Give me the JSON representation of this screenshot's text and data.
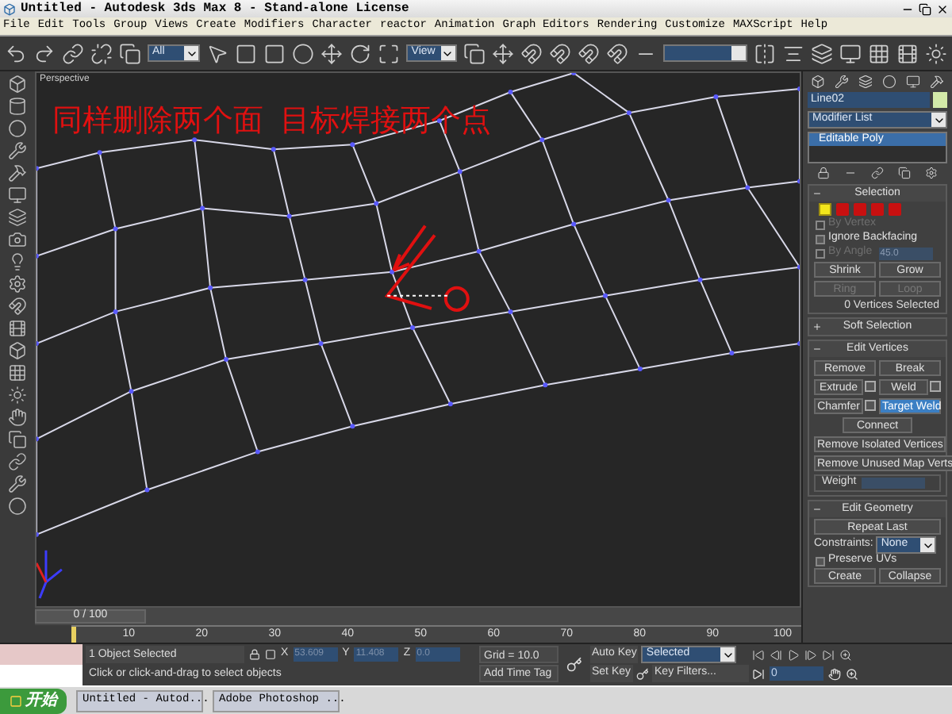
{
  "window": {
    "title": "Untitled - Autodesk 3ds Max 8  - Stand-alone License"
  },
  "menu": [
    "File",
    "Edit",
    "Tools",
    "Group",
    "Views",
    "Create",
    "Modifiers",
    "Character",
    "reactor",
    "Animation",
    "Graph Editors",
    "Rendering",
    "Customize",
    "MAXScript",
    "Help"
  ],
  "toolbar": {
    "selection_filter": "All",
    "reference_coord": "View"
  },
  "viewport": {
    "label": "Perspective",
    "annotation": "同样删除两个面  目标焊接两个点"
  },
  "command_panel": {
    "object_name": "Line02",
    "modifier_list": "Modifier List",
    "stack": [
      {
        "label": "Editable Poly",
        "selected": true
      }
    ],
    "selection": {
      "title": "Selection",
      "expanded": true,
      "subobjects": [
        {
          "selected": true
        },
        {
          "selected": false
        },
        {
          "selected": false
        },
        {
          "selected": false
        },
        {
          "selected": false
        }
      ],
      "checks": [
        {
          "label": "By Vertex",
          "checked": false,
          "disabled": true
        },
        {
          "label": "Ignore Backfacing",
          "checked": false,
          "disabled": false
        }
      ],
      "by_angle": {
        "label": "By Angle",
        "checked": false,
        "disabled": true,
        "value": "45.0"
      },
      "buttons": [
        {
          "label": "Shrink",
          "disabled": false
        },
        {
          "label": "Grow",
          "disabled": false
        },
        {
          "label": "Ring",
          "disabled": true
        },
        {
          "label": "Loop",
          "disabled": true
        }
      ],
      "status": "0 Vertices Selected"
    },
    "soft_selection": {
      "title": "Soft Selection",
      "expanded": false
    },
    "edit_vertices": {
      "title": "Edit Vertices",
      "expanded": true,
      "buttons": [
        {
          "label": "Remove",
          "kind": "half",
          "selected": false
        },
        {
          "label": "Break",
          "kind": "half",
          "selected": false
        },
        {
          "label": "Extrude",
          "kind": "half_settings",
          "selected": false
        },
        {
          "label": "Weld",
          "kind": "half_settings",
          "selected": false
        },
        {
          "label": "Chamfer",
          "kind": "half_settings",
          "selected": false
        },
        {
          "label": "Target Weld",
          "kind": "half",
          "selected": true
        },
        {
          "label": "Connect",
          "kind": "center",
          "selected": false
        },
        {
          "label": "Remove Isolated Vertices",
          "kind": "full",
          "selected": false
        },
        {
          "label": "Remove Unused Map Verts",
          "kind": "full",
          "selected": false
        }
      ],
      "weight_label": "Weight"
    },
    "edit_geometry": {
      "title": "Edit Geometry",
      "expanded": true,
      "repeat": "Repeat Last",
      "constraints_label": "Constraints:",
      "constraints_value": "None",
      "preserve_uvs": {
        "label": "Preserve UVs",
        "checked": false,
        "disabled": false
      },
      "buttons": [
        "Create",
        "Collapse"
      ]
    }
  },
  "timeline": {
    "position": "0 / 100",
    "level": 0,
    "ticks": [
      "10",
      "20",
      "30",
      "40",
      "50",
      "60",
      "70",
      "80",
      "90",
      "100"
    ]
  },
  "status": {
    "selection": "1 Object Selected",
    "prompt": "Click or click-and-drag to select objects",
    "x_label": "X",
    "x_value": "53.609",
    "y_label": "Y",
    "y_value": "11.408",
    "z_label": "Z",
    "z_value": "0.0",
    "grid": "Grid = 10.0",
    "add_time_tag": "Add Time Tag",
    "auto_key": "Auto Key",
    "key_mode": "Selected",
    "set_key": "Set Key",
    "key_filters": "Key Filters...",
    "frame": "0"
  },
  "taskbar": {
    "start": "开始",
    "tasks": [
      "Untitled - Autod...",
      "Adobe Photoshop ..."
    ]
  }
}
